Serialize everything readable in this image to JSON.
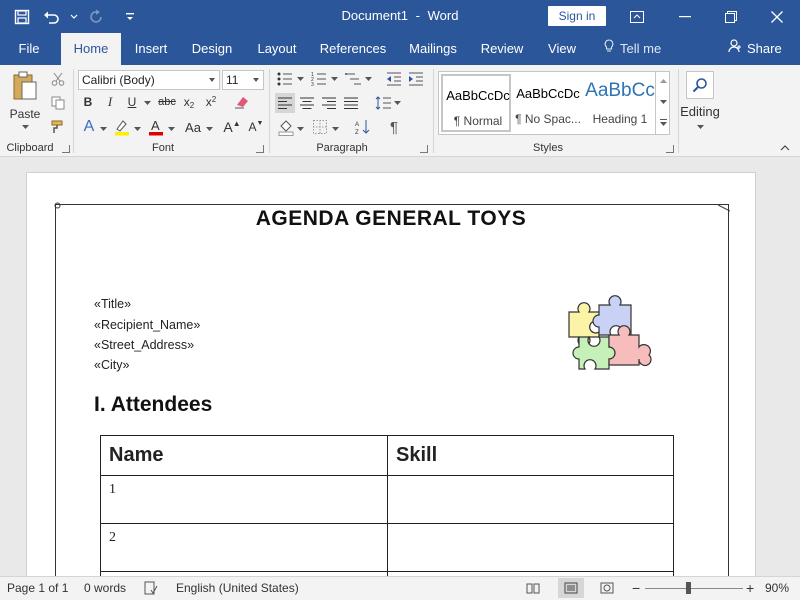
{
  "window": {
    "title": "Document1",
    "title_sep": "-",
    "app_name": "Word",
    "signin_label": "Sign in"
  },
  "tabs": [
    {
      "label": "File"
    },
    {
      "label": "Home"
    },
    {
      "label": "Insert"
    },
    {
      "label": "Design"
    },
    {
      "label": "Layout"
    },
    {
      "label": "References"
    },
    {
      "label": "Mailings"
    },
    {
      "label": "Review"
    },
    {
      "label": "View"
    }
  ],
  "active_tab": "Home",
  "tell_me": "Tell me",
  "share": "Share",
  "ribbon": {
    "clipboard": {
      "label": "Clipboard",
      "paste_label": "Paste"
    },
    "font": {
      "label": "Font",
      "font_name": "Calibri (Body)",
      "font_size": "11"
    },
    "paragraph": {
      "label": "Paragraph"
    },
    "styles": {
      "label": "Styles",
      "items": [
        {
          "sample": "AaBbCcDc",
          "name": "¶ Normal"
        },
        {
          "sample": "AaBbCcDc",
          "name": "¶ No Spac..."
        },
        {
          "sample": "AaBbCc",
          "name": "Heading 1"
        }
      ]
    },
    "editing": {
      "label": "Editing"
    }
  },
  "document": {
    "title": "AGENDA GENERAL TOYS",
    "merge_fields": [
      "«Title»",
      "«Recipient_Name»",
      "«Street_Address»",
      "«City»"
    ],
    "section_heading": "I. Attendees",
    "table": {
      "headers": [
        "Name",
        "Skill"
      ],
      "rows": [
        [
          "1",
          ""
        ],
        [
          "2",
          ""
        ]
      ]
    }
  },
  "status": {
    "page": "Page 1 of 1",
    "words": "0 words",
    "language": "English (United States)",
    "zoom": "90%"
  },
  "colors": {
    "accent": "#2b579a",
    "ribbon_bg": "#f3f3f3",
    "canvas_bg": "#e9e9e9"
  }
}
